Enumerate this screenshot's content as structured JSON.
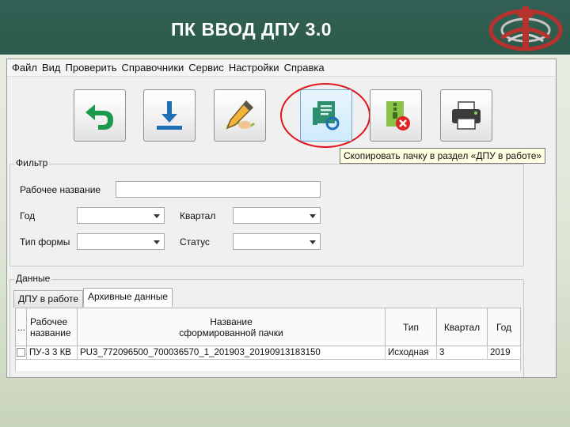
{
  "slide": {
    "title": "ПК ВВОД  ДПУ 3.0"
  },
  "menu": [
    "Файл",
    "Вид",
    "Проверить",
    "Справочники",
    "Сервис",
    "Настройки",
    "Справка"
  ],
  "toolbar": {
    "buttons": [
      {
        "icon": "undo-arrow-icon"
      },
      {
        "icon": "download-icon"
      },
      {
        "icon": "edit-pen-icon"
      },
      {
        "icon": "copy-to-work-icon"
      },
      {
        "icon": "archive-delete-icon"
      },
      {
        "icon": "printer-icon"
      }
    ],
    "tooltip": "Скопировать пачку в раздел «ДПУ в работе»"
  },
  "filter": {
    "title": "Фильтр",
    "work_name_label": "Рабочее название",
    "year_label": "Год",
    "quarter_label": "Квартал",
    "form_type_label": "Тип формы",
    "status_label": "Статус"
  },
  "data_section": {
    "title": "Данные",
    "tabs": [
      "ДПУ в работе",
      "Архивные данные"
    ],
    "selected_tab": "Архивные данные",
    "columns": [
      "...",
      "Рабочее название",
      "Название сформированной пачки",
      "Тип",
      "Квартал",
      "Год"
    ],
    "rows": [
      {
        "work_name": "ПУ-3 3 КВ",
        "package_name": "PU3_772096500_700036570_1_201903_20190913183150",
        "type": "Исходная",
        "quarter": "3",
        "year": "2019"
      }
    ]
  },
  "colors": {
    "header_bg": "#2b5a4c",
    "highlight": "#e1141b",
    "tooltip_bg": "#ffffe1",
    "logo": "#b8322d"
  }
}
